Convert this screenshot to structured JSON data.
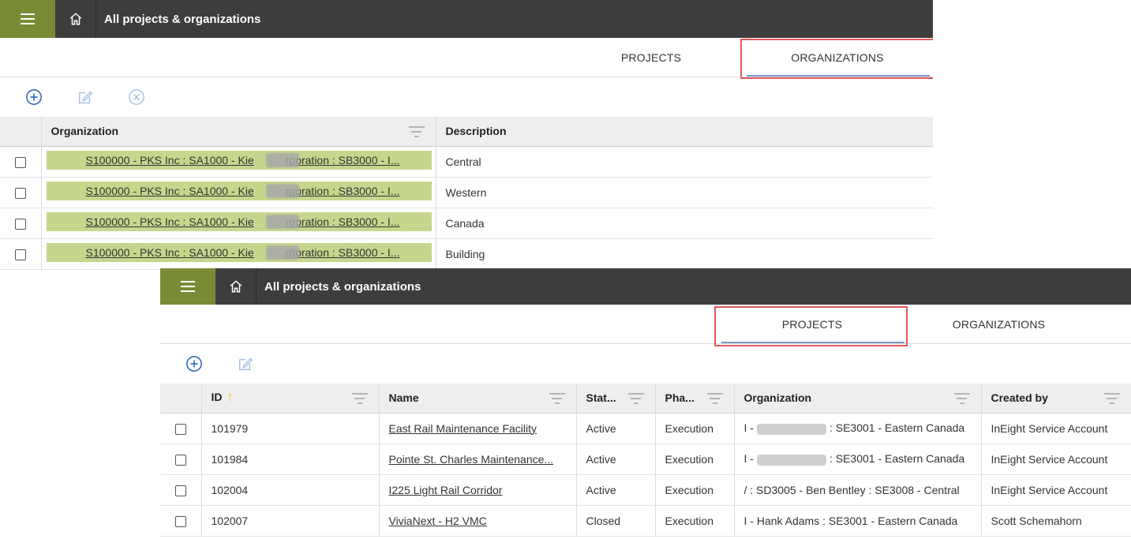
{
  "top_panel": {
    "header_title": "All projects & organizations",
    "tabs": {
      "projects": "PROJECTS",
      "organizations": "ORGANIZATIONS",
      "active": "ORGANIZATIONS"
    },
    "table": {
      "headers": {
        "organization": "Organization",
        "description": "Description"
      },
      "rows": [
        {
          "org_prefix": "S100000 - PKS Inc : SA1000 - Kie",
          "org_suffix": "rporation : SB3000 - I...",
          "description": "Central"
        },
        {
          "org_prefix": "S100000 - PKS Inc : SA1000 - Kie",
          "org_suffix": "rporation : SB3000 - I...",
          "description": "Western"
        },
        {
          "org_prefix": "S100000 - PKS Inc : SA1000 - Kie",
          "org_suffix": "rporation : SB3000 - I...",
          "description": "Canada"
        },
        {
          "org_prefix": "S100000 - PKS Inc : SA1000 - Kie",
          "org_suffix": "rporation : SB3000 - I...",
          "description": "Building"
        }
      ]
    }
  },
  "bottom_panel": {
    "header_title": "All projects & organizations",
    "tabs": {
      "projects": "PROJECTS",
      "organizations": "ORGANIZATIONS",
      "active": "PROJECTS"
    },
    "table": {
      "headers": {
        "id": "ID",
        "name": "Name",
        "status": "Stat...",
        "phase": "Pha...",
        "organization": "Organization",
        "created_by": "Created by"
      },
      "sort_indicator": "↑",
      "rows": [
        {
          "id": "101979",
          "name": "East Rail Maintenance Facility",
          "status": "Active",
          "phase": "Execution",
          "org_prefix": "I -",
          "org_suffix": ": SE3001 - Eastern Canada",
          "created_by": "InEight Service Account"
        },
        {
          "id": "101984",
          "name": "Pointe St. Charles Maintenance...",
          "status": "Active",
          "phase": "Execution",
          "org_prefix": "I -",
          "org_suffix": ": SE3001 - Eastern Canada",
          "created_by": "InEight Service Account"
        },
        {
          "id": "102004",
          "name": "I225 Light Rail Corridor",
          "status": "Active",
          "phase": "Execution",
          "org_prefix": "",
          "org_suffix": "/ : SD3005 - Ben Bentley : SE3008 - Central",
          "created_by": "InEight Service Account"
        },
        {
          "id": "102007",
          "name": "ViviaNext - H2 VMC",
          "status": "Closed",
          "phase": "Execution",
          "org_prefix": "",
          "org_suffix": "I - Hank Adams : SE3001 - Eastern Canada",
          "created_by": "Scott Schemahorn"
        }
      ]
    }
  },
  "colors": {
    "topbar": "#3d3d3d",
    "menu_button": "#7a8b35",
    "org_chip": "#c6d78d",
    "highlight_box": "#e05a5a",
    "active_tab_underline": "#7b9bc9",
    "toolbar_icon": "#1f5fb5",
    "sort_arrow": "#f2b521"
  },
  "icons": [
    "hamburger-icon",
    "home-icon",
    "add-circle-icon",
    "edit-icon",
    "delete-circle-icon",
    "filter-icon"
  ]
}
